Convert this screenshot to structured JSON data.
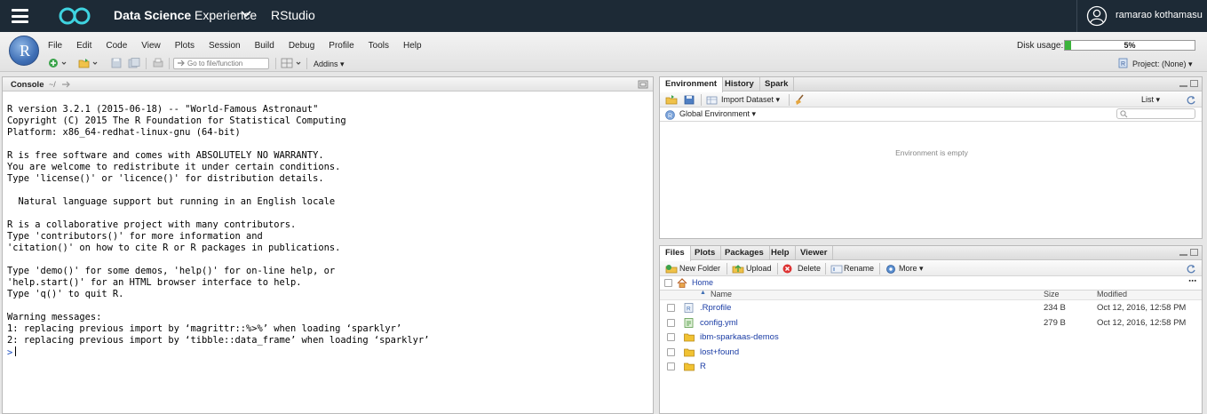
{
  "topbar": {
    "product_bold": "Data Science",
    "product_rest": " Experience",
    "app_name": "RStudio",
    "user_name": "ramarao kothamasu"
  },
  "menubar": [
    "File",
    "Edit",
    "Code",
    "View",
    "Plots",
    "Session",
    "Build",
    "Debug",
    "Profile",
    "Tools",
    "Help"
  ],
  "disk": {
    "label": "Disk usage:",
    "value_text": "5%",
    "fraction": 0.05
  },
  "toolbar": {
    "goto_placeholder": "Go to file/function",
    "addins": "Addins",
    "project": "Project: (None)"
  },
  "console": {
    "title": "Console",
    "path": "~/",
    "lines": [
      "R version 3.2.1 (2015-06-18) -- \"World-Famous Astronaut\"",
      "Copyright (C) 2015 The R Foundation for Statistical Computing",
      "Platform: x86_64-redhat-linux-gnu (64-bit)",
      "",
      "R is free software and comes with ABSOLUTELY NO WARRANTY.",
      "You are welcome to redistribute it under certain conditions.",
      "Type 'license()' or 'licence()' for distribution details.",
      "",
      "  Natural language support but running in an English locale",
      "",
      "R is a collaborative project with many contributors.",
      "Type 'contributors()' for more information and",
      "'citation()' on how to cite R or R packages in publications.",
      "",
      "Type 'demo()' for some demos, 'help()' for on-line help, or",
      "'help.start()' for an HTML browser interface to help.",
      "Type 'q()' to quit R.",
      "",
      "Warning messages:",
      "1: replacing previous import by ‘magrittr::%>%’ when loading ‘sparklyr’",
      "2: replacing previous import by ‘tibble::data_frame’ when loading ‘sparklyr’"
    ],
    "prompt": ">"
  },
  "environment": {
    "tabs": [
      "Environment",
      "History",
      "Spark"
    ],
    "import_dataset": "Import Dataset",
    "list_view": "List",
    "global_env": "Global Environment",
    "empty_msg": "Environment is empty"
  },
  "files": {
    "tabs": [
      "Files",
      "Plots",
      "Packages",
      "Help",
      "Viewer"
    ],
    "toolbar": {
      "new_folder": "New Folder",
      "upload": "Upload",
      "delete": "Delete",
      "rename": "Rename",
      "more": "More"
    },
    "breadcrumb": "Home",
    "columns": {
      "name": "Name",
      "size": "Size",
      "modified": "Modified"
    },
    "rows": [
      {
        "name": ".Rprofile",
        "size": "234 B",
        "modified": "Oct 12, 2016, 12:58 PM",
        "icon": "r-file-icon"
      },
      {
        "name": "config.yml",
        "size": "279 B",
        "modified": "Oct 12, 2016, 12:58 PM",
        "icon": "yml-file-icon"
      },
      {
        "name": "ibm-sparkaas-demos",
        "size": "",
        "modified": "",
        "icon": "folder-icon"
      },
      {
        "name": "lost+found",
        "size": "",
        "modified": "",
        "icon": "folder-icon"
      },
      {
        "name": "R",
        "size": "",
        "modified": "",
        "icon": "folder-icon"
      }
    ]
  },
  "colors": {
    "topbar_bg": "#1d2a36",
    "link_blue": "#1b3da5",
    "disk_fill": "#3cb43c",
    "folder_yellow": "#f1c232"
  }
}
